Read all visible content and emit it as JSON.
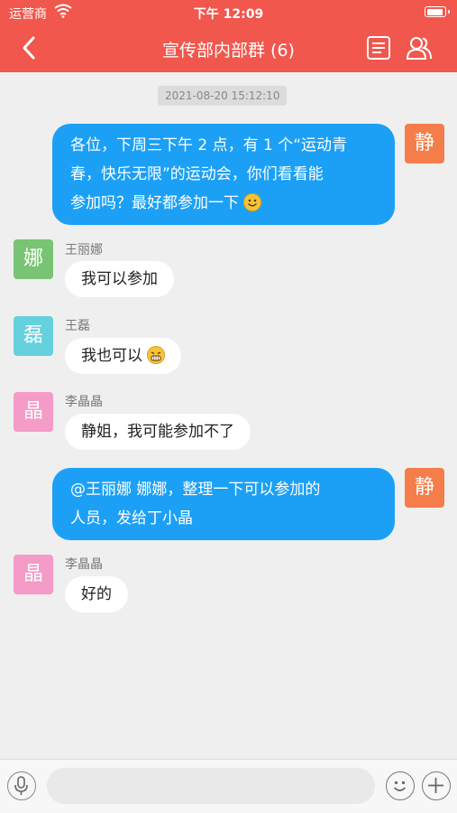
{
  "status_bar": {
    "carrier": "运营商",
    "time": "下午 12:09"
  },
  "nav": {
    "title": "宣传部内部群 (6)"
  },
  "chat": {
    "timestamp": "2021-08-20 15:12:10",
    "messages": [
      {
        "avatar": "静",
        "avatar_color": "#f57d4a",
        "lines": [
          "各位，下周三下午 2 点，有 1 个“运动青",
          "春，快乐无限”的运动会，你们看看能",
          "参加吗？最好都参加一下"
        ]
      },
      {
        "name": "王丽娜",
        "avatar": "娜",
        "avatar_color": "#78c472",
        "text": "我可以参加"
      },
      {
        "name": "王磊",
        "avatar": "磊",
        "avatar_color": "#65d1dc",
        "text": "我也可以"
      },
      {
        "name": "李晶晶",
        "avatar": "晶",
        "avatar_color": "#f59bc7",
        "text": "静姐，我可能参加不了"
      },
      {
        "avatar": "静",
        "avatar_color": "#f57d4a",
        "lines": [
          "@王丽娜 娜娜，整理一下可以参加的",
          "人员，发给丁小晶"
        ]
      },
      {
        "name": "李晶晶",
        "avatar": "晶",
        "avatar_color": "#f59bc7",
        "text": "好的"
      }
    ]
  },
  "colors": {
    "brand": "#f1574d",
    "outgoing_bubble": "#1ca0f5",
    "background": "#efefef"
  },
  "icons": [
    "wifi-icon",
    "battery-icon",
    "back-icon",
    "notes-icon",
    "group-members-icon",
    "smile-emoji",
    "grin-emoji",
    "microphone-icon",
    "emoji-icon",
    "plus-icon"
  ]
}
